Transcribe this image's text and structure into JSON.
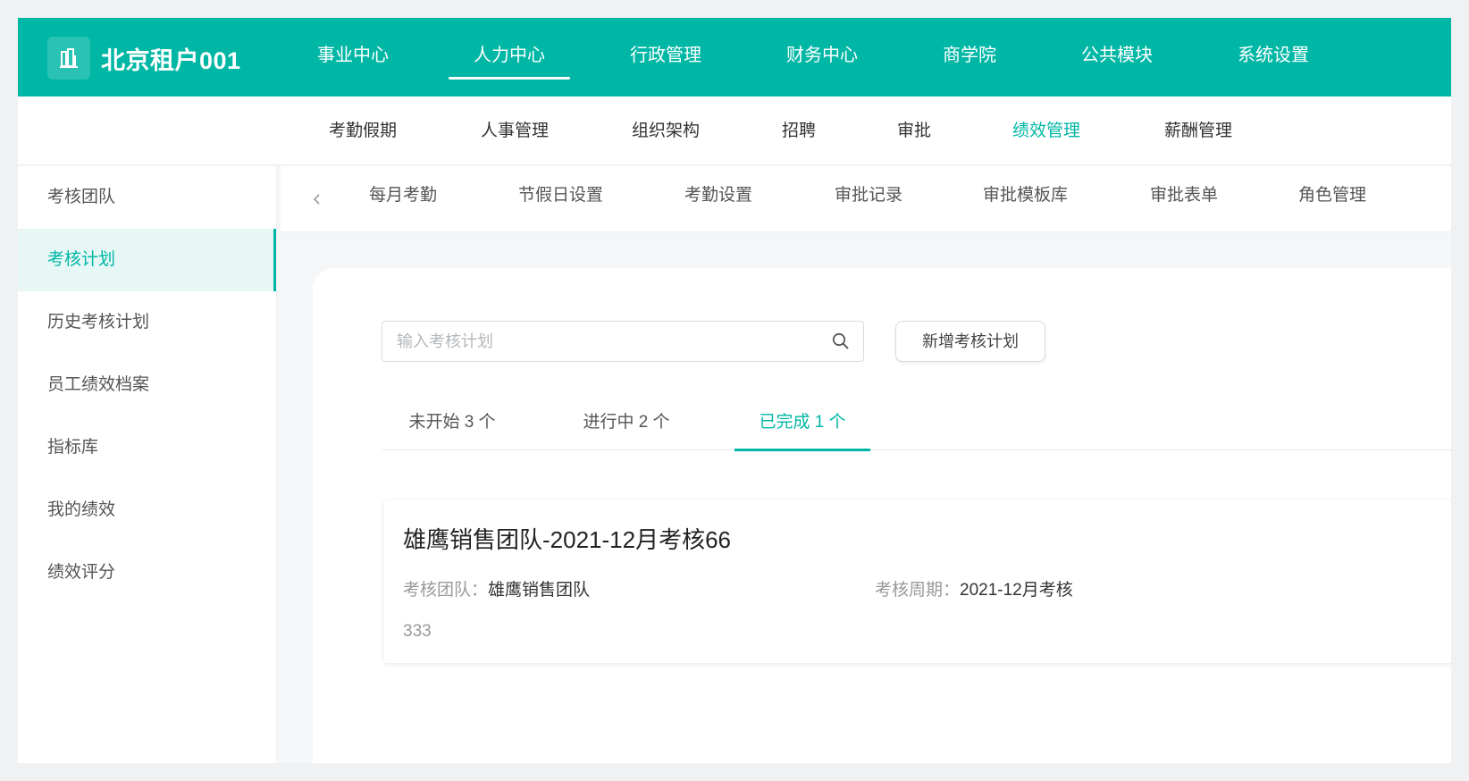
{
  "brand": {
    "name": "北京租户001",
    "logo_icon": "building-icon"
  },
  "top_nav": {
    "items": [
      "事业中心",
      "人力中心",
      "行政管理",
      "财务中心",
      "商学院",
      "公共模块",
      "系统设置"
    ],
    "active_index": 1
  },
  "module_nav": {
    "items": [
      "考勤假期",
      "人事管理",
      "组织架构",
      "招聘",
      "审批",
      "绩效管理",
      "薪酬管理"
    ],
    "active_index": 5
  },
  "sidebar": {
    "items": [
      "考核团队",
      "考核计划",
      "历史考核计划",
      "员工绩效档案",
      "指标库",
      "我的绩效",
      "绩效评分"
    ],
    "active_index": 1
  },
  "sub_nav": {
    "items": [
      "每月考勤",
      "节假日设置",
      "考勤设置",
      "审批记录",
      "审批模板库",
      "审批表单",
      "角色管理"
    ]
  },
  "search": {
    "placeholder": "输入考核计划",
    "value": ""
  },
  "add_button": {
    "label": "新增考核计划"
  },
  "status_tabs": {
    "items": [
      "未开始 3 个",
      "进行中 2 个",
      "已完成 1 个"
    ],
    "active_index": 2
  },
  "plans": [
    {
      "title": "雄鹰销售团队-2021-12月考核66",
      "team_label": "考核团队：",
      "team_value": "雄鹰销售团队",
      "period_label": "考核周期：",
      "period_value": "2021-12月考核",
      "description": "333"
    }
  ],
  "colors": {
    "accent": "#00b7a5",
    "active_bg": "#e6f7f5",
    "text": "#333333",
    "muted": "#999999"
  }
}
